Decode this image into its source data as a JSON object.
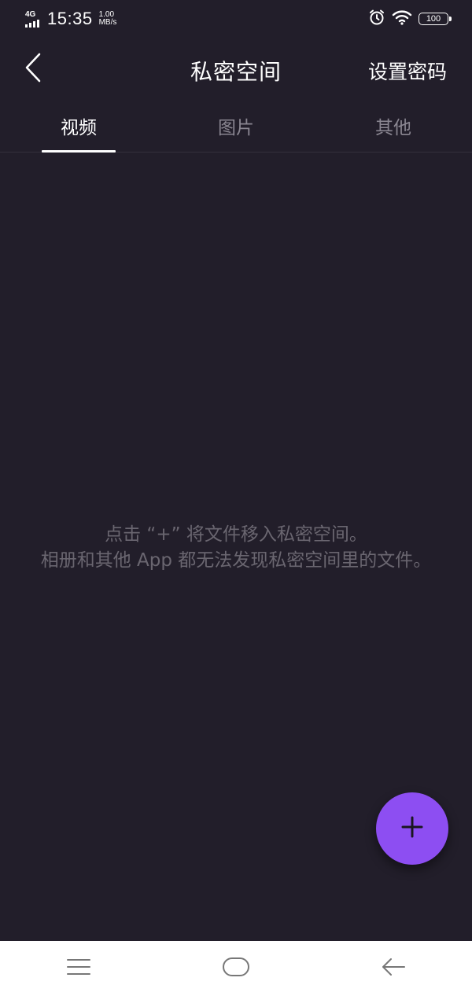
{
  "status_bar": {
    "network": "4G",
    "time": "15:35",
    "speed_value": "1.00",
    "speed_unit": "MB/s",
    "battery": "100",
    "icons": [
      "signal-icon",
      "alarm-icon",
      "wifi-icon",
      "battery-icon"
    ]
  },
  "header": {
    "back_icon": "chevron-left-icon",
    "title": "私密空间",
    "action_label": "设置密码"
  },
  "tabs": [
    {
      "label": "视频",
      "active": true
    },
    {
      "label": "图片",
      "active": false
    },
    {
      "label": "其他",
      "active": false
    }
  ],
  "empty_state": {
    "line1": "点击 “+” 将文件移入私密空间。",
    "line2": "相册和其他 App 都无法发现私密空间里的文件。"
  },
  "fab": {
    "icon": "plus-icon"
  },
  "nav_bar": {
    "icons": [
      "menu-icon",
      "home-icon",
      "back-arrow-icon"
    ]
  },
  "colors": {
    "background": "#221e2a",
    "accent": "#8d4ef2",
    "text_primary": "#ffffff",
    "text_muted": "#8a8691",
    "text_hint": "#6a6670",
    "nav_background": "#ffffff"
  }
}
